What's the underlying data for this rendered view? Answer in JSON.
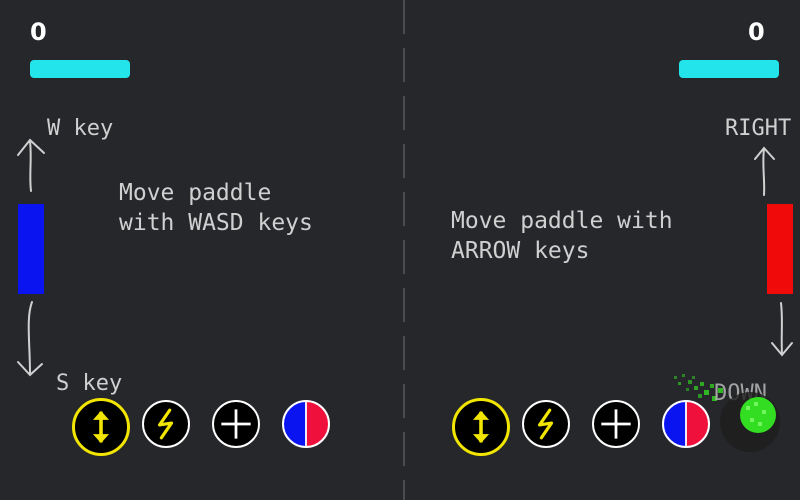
{
  "scores": {
    "left": "0",
    "right": "0"
  },
  "colors": {
    "background": "#25272b",
    "power_bar": "#22e4ea",
    "left_paddle": "#0a14f0",
    "right_paddle": "#f00a0a",
    "powerup_ring_selected": "#f2e600",
    "powerup_icon": "#f2e600",
    "ball": "#33dd22"
  },
  "left": {
    "up_key_label": "W key",
    "down_key_label": "S key",
    "instructions": "Move paddle\nwith WASD keys"
  },
  "right": {
    "up_key_label": "RIGHT",
    "down_key_label": "DOWN",
    "instructions": "Move paddle with\nARROW keys"
  },
  "powerups": [
    {
      "icon": "resize-arrows-icon"
    },
    {
      "icon": "lightning-icon"
    },
    {
      "icon": "crosshair-icon"
    },
    {
      "icon": "split-color-icon"
    }
  ]
}
